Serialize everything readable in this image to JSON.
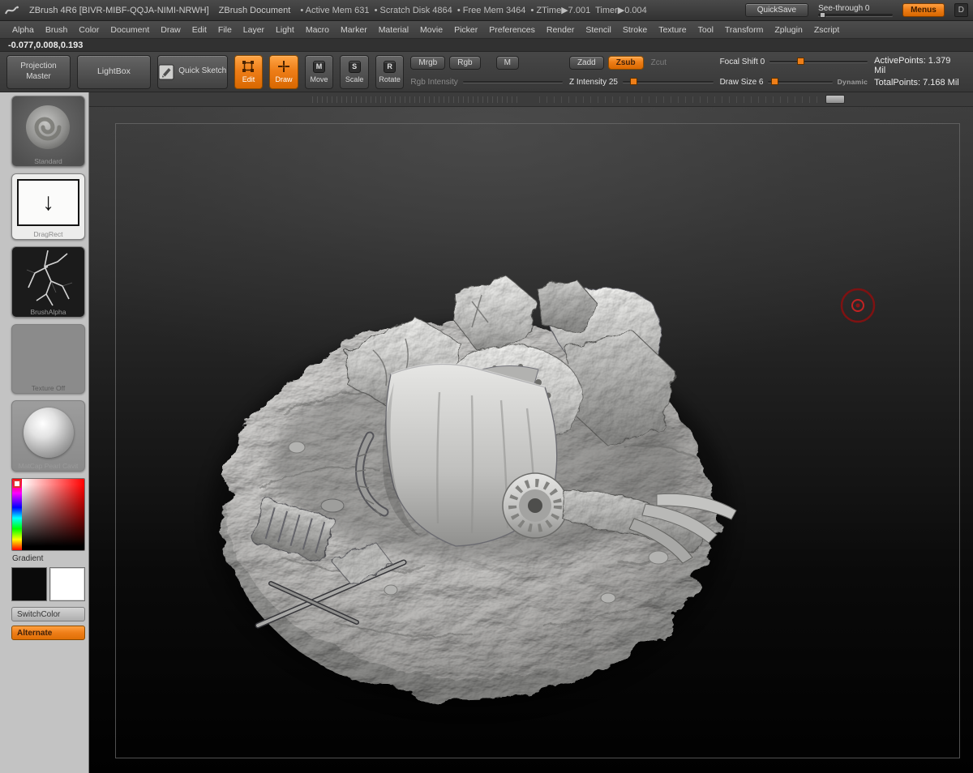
{
  "title_bar": {
    "app_title": "ZBrush 4R6 [BIVR-MIBF-QQJA-NIMI-NRWH]",
    "document_label": "ZBrush Document",
    "stats": "• Active Mem 631  • Scratch Disk 4864  • Free Mem 3464  • ZTime▶7.001  Timer▶0.004",
    "quicksave": "QuickSave",
    "see_through": "See-through 0",
    "menus": "Menus",
    "overflow": "D"
  },
  "menu_bar": {
    "items": [
      "Alpha",
      "Brush",
      "Color",
      "Document",
      "Draw",
      "Edit",
      "File",
      "Layer",
      "Light",
      "Macro",
      "Marker",
      "Material",
      "Movie",
      "Picker",
      "Preferences",
      "Render",
      "Stencil",
      "Stroke",
      "Texture",
      "Tool",
      "Transform",
      "Zplugin",
      "Zscript"
    ]
  },
  "coords_readout": "-0.077,0.008,0.193",
  "toolbar": {
    "projection_master": "Projection Master",
    "lightbox": "LightBox",
    "quick_sketch": "Quick Sketch",
    "edit": "Edit",
    "draw": "Draw",
    "move": "Move",
    "scale": "Scale",
    "rotate": "Rotate",
    "move_key": "M",
    "scale_key": "S",
    "rotate_key": "R",
    "mrgb": "Mrgb",
    "rgb": "Rgb",
    "m": "M",
    "rgb_intensity": "Rgb Intensity",
    "zadd": "Zadd",
    "zsub": "Zsub",
    "zcut": "Zcut",
    "z_intensity": "Z Intensity 25",
    "focal_shift": "Focal Shift 0",
    "draw_size": "Draw Size 6",
    "dynamic": "Dynamic",
    "active_points": "ActivePoints: 1.379 Mil",
    "total_points": "TotalPoints: 7.168 Mil"
  },
  "sidebar": {
    "brush": {
      "label": "Standard"
    },
    "stroke": {
      "label": "DragRect",
      "arrow": "↓"
    },
    "alpha": {
      "label": "BrushAlpha"
    },
    "texture": {
      "label": "Texture  Off"
    },
    "material": {
      "label": "MatCap Pearl Cavit"
    },
    "gradient_label": "Gradient",
    "switch_color": "SwitchColor",
    "alternate": "Alternate"
  },
  "colors": {
    "accent_orange": "#ee7e18",
    "titlebar_bg": "#3a3a3a",
    "sidebar_bg": "#c3c3c3",
    "canvas_top": "#3d3d3d",
    "canvas_bottom": "#010101",
    "cursor_red": "#8a1515",
    "sculpt_gray": "#c4c3c1"
  }
}
